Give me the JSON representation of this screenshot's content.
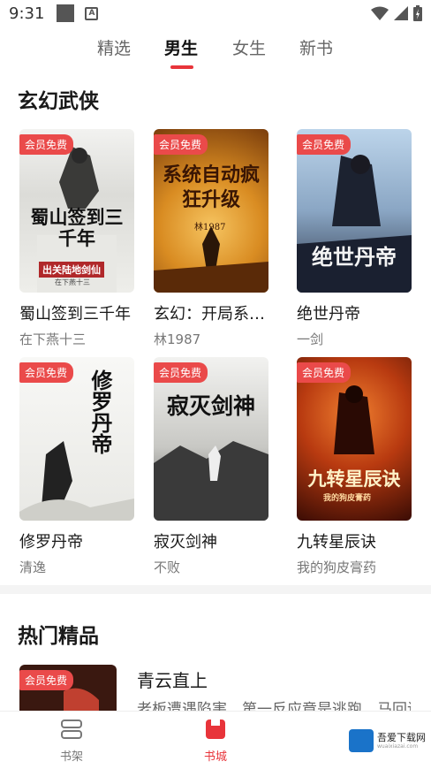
{
  "status_bar": {
    "time": "9:31",
    "notif_letter": "A"
  },
  "tabs": [
    {
      "label": "精选",
      "active": false
    },
    {
      "label": "男生",
      "active": true
    },
    {
      "label": "女生",
      "active": false
    },
    {
      "label": "新书",
      "active": false
    }
  ],
  "section_fantasy": {
    "title": "玄幻武侠",
    "books": [
      {
        "title": "蜀山签到三千年",
        "author": "在下燕十三",
        "badge": "会员免费",
        "cover_text": "蜀山签到三千年",
        "cover_sub": "出关陆地剑仙",
        "cover_byline": "在下燕十三"
      },
      {
        "title": "玄幻：开局系统自动疯狂升级",
        "author": "林1987",
        "badge": "会员免费",
        "cover_text": "系统自动疯狂升级",
        "cover_byline": "林1987"
      },
      {
        "title": "绝世丹帝",
        "author": "一剑",
        "badge": "会员免费",
        "cover_text": "绝世丹帝"
      },
      {
        "title": "修罗丹帝",
        "author": "清逸",
        "badge": "会员免费",
        "cover_text": "修罗丹帝"
      },
      {
        "title": "寂灭剑神",
        "author": "不败",
        "badge": "会员免费",
        "cover_text": "寂灭剑神"
      },
      {
        "title": "九转星辰诀",
        "author": "我的狗皮膏药",
        "badge": "会员免费",
        "cover_text": "九转星辰诀",
        "cover_byline": "我的狗皮膏药"
      }
    ]
  },
  "section_hot": {
    "title": "热门精品",
    "book": {
      "title": "青云直上",
      "description": "老板遭遇陷害，第一反应竟是逃跑，马回说",
      "badge": "会员免费"
    }
  },
  "bottom_nav": [
    {
      "label": "书架",
      "icon": "bookshelf-icon",
      "active": false
    },
    {
      "label": "书城",
      "icon": "bookstore-icon",
      "active": true
    }
  ],
  "watermark": {
    "text": "吾爱下载网",
    "sub": "wuaixiazai.com"
  },
  "colors": {
    "accent": "#e8343a",
    "badge": "#ea4a4a"
  }
}
